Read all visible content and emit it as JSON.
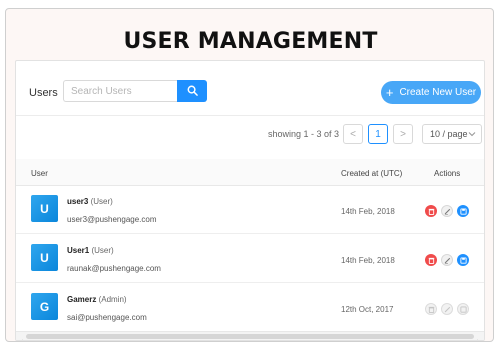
{
  "page": {
    "title": "USER MANAGEMENT"
  },
  "toolbar": {
    "users_label": "Users",
    "search_placeholder": "Search Users",
    "create_label": "Create New User"
  },
  "pagination": {
    "showing": "showing 1 - 3 of 3",
    "prev": "<",
    "current": "1",
    "next": ">",
    "per_page": "10 / page"
  },
  "table": {
    "headers": {
      "user": "User",
      "created": "Created at (UTC)",
      "actions": "Actions"
    },
    "rows": [
      {
        "initial": "U",
        "name": "user3",
        "role": "(User)",
        "email": "user3@pushengage.com",
        "created": "14th Feb, 2018",
        "actions_enabled": true
      },
      {
        "initial": "U",
        "name": "User1",
        "role": "(User)",
        "email": "raunak@pushengage.com",
        "created": "14th Feb, 2018",
        "actions_enabled": true
      },
      {
        "initial": "G",
        "name": "Gamerz",
        "role": "(Admin)",
        "email": "sai@pushengage.com",
        "created": "12th Oct, 2017",
        "actions_enabled": false
      }
    ]
  },
  "colors": {
    "accent": "#1e90ff",
    "create_button": "#48a7f7",
    "delete": "#f04b4b",
    "avatar": "#1a95e6"
  },
  "icons": {
    "search": "search-icon",
    "plus": "plus-icon",
    "delete": "trash-icon",
    "edit": "pencil-icon",
    "save": "save-icon",
    "per_page": "chevron-down-icon"
  }
}
